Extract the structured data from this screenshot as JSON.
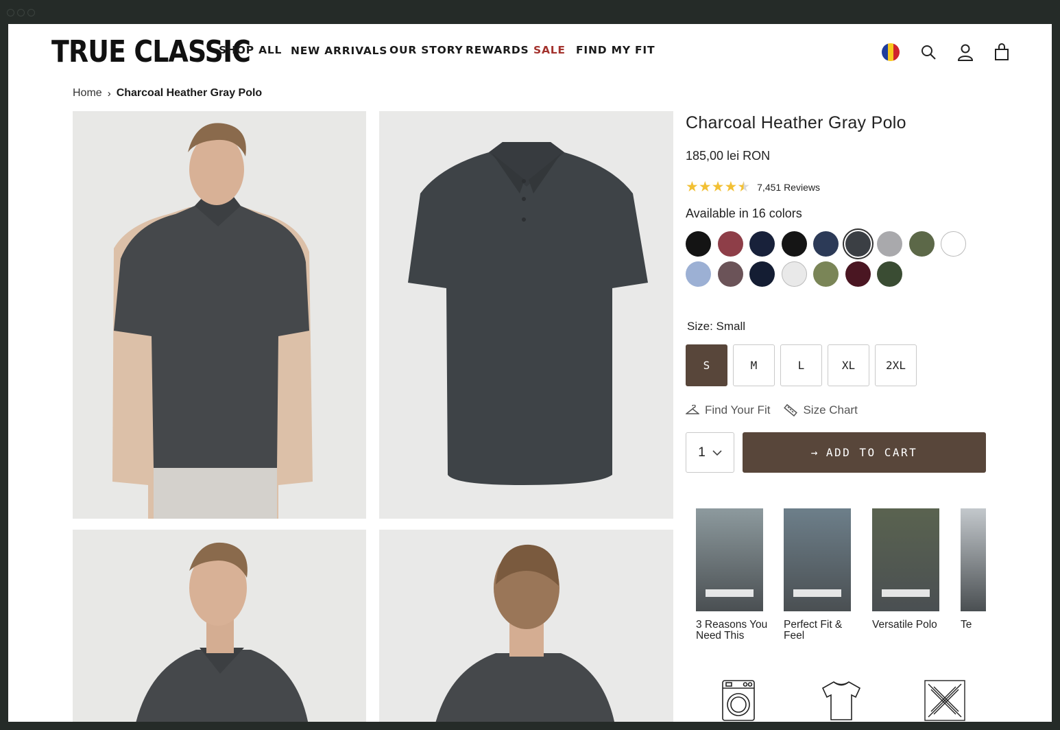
{
  "brand": {
    "logo": "TRUE CLASSIC"
  },
  "nav": {
    "items": [
      "SHOP ALL",
      "NEW ARRIVALS",
      "OUR STORY",
      "REWARDS",
      "SALE",
      "FIND MY FIT"
    ]
  },
  "header_icons": [
    "romania-flag-icon",
    "search-icon",
    "account-icon",
    "cart-icon"
  ],
  "breadcrumb": {
    "home": "Home",
    "separator": "›",
    "current": "Charcoal Heather Gray Polo"
  },
  "product": {
    "title": "Charcoal Heather Gray Polo",
    "price": "185,00 lei RON",
    "rating": {
      "stars": "★★★★★",
      "value": 4.5,
      "reviews": "7,451 Reviews"
    },
    "colors_label": "Available in 16 colors",
    "colors": [
      "#141414",
      "#8e3e48",
      "#18213a",
      "#151515",
      "#2c3a57",
      "#3b3f44",
      "#a9a9ac",
      "#5c6848",
      "#ffffff",
      "#9cb0d4",
      "#6b5358",
      "#141d33",
      "#e9e9e9",
      "#7a8557",
      "#4a1622",
      "#3a4c33"
    ],
    "selected_color_index": 5,
    "size_label": "Size: Small",
    "sizes": [
      "S",
      "M",
      "L",
      "XL",
      "2XL"
    ],
    "selected_size_index": 0,
    "find_fit": "Find Your Fit",
    "size_chart": "Size Chart",
    "quantity": "1",
    "add_to_cart": "ADD TO CART",
    "add_to_cart_arrow": "→"
  },
  "videos": [
    {
      "title": "3 Reasons You Need This",
      "bg": "#8d9a9e"
    },
    {
      "title": "Perfect Fit & Feel",
      "bg": "#6d7f8a"
    },
    {
      "title": "Versatile Polo",
      "bg": "#5a6350"
    },
    {
      "title": "Te",
      "bg": "#c3c8cc"
    }
  ],
  "care_icons": [
    "washing-machine-icon",
    "t-shirt-icon",
    "no-iron-icon"
  ],
  "colors": {
    "accent": "#58463a",
    "sale": "#a3322d",
    "star": "#f2c034"
  }
}
